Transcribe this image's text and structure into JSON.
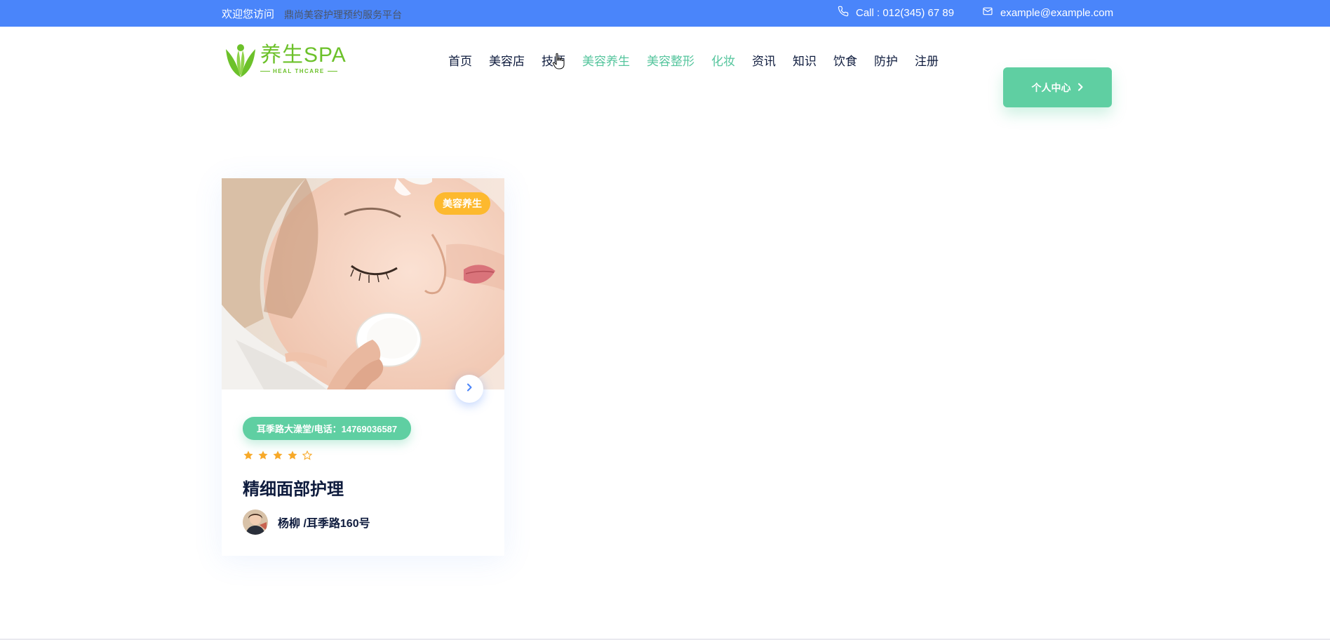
{
  "topbar": {
    "welcome": "欢迎您访问",
    "tagline": "鼎尚美容护理预约服务平台",
    "call": "Call : 012(345) 67 89",
    "email": "example@example.com"
  },
  "logo": {
    "main": "养生SPA",
    "sub": "HEAL THCARE"
  },
  "nav": {
    "items": [
      {
        "label": "首页"
      },
      {
        "label": "美容店"
      },
      {
        "label": "技师"
      },
      {
        "label": "美容养生"
      },
      {
        "label": "美容整形"
      },
      {
        "label": "化妆"
      },
      {
        "label": "资讯"
      },
      {
        "label": "知识"
      },
      {
        "label": "饮食"
      },
      {
        "label": "防护"
      },
      {
        "label": "注册"
      }
    ],
    "highlight_color": "#55c59d"
  },
  "header": {
    "user_center_label": "个人中心"
  },
  "card": {
    "category": "美容养生",
    "location": "耳季路大澡堂/电话：14769036587",
    "rating": 4,
    "rating_max": 5,
    "title": "精细面部护理",
    "author": "杨柳 /耳季路160号"
  },
  "colors": {
    "topbar": "#4a85fa",
    "accent_green": "#5fcfa2",
    "badge_orange": "#fdb92e",
    "logo_green": "#6cc12a",
    "star": "#f7a928"
  },
  "icons": {
    "call": "phone-icon",
    "email": "envelope-icon",
    "next": "chevron-right-icon",
    "star": "star-icon"
  }
}
